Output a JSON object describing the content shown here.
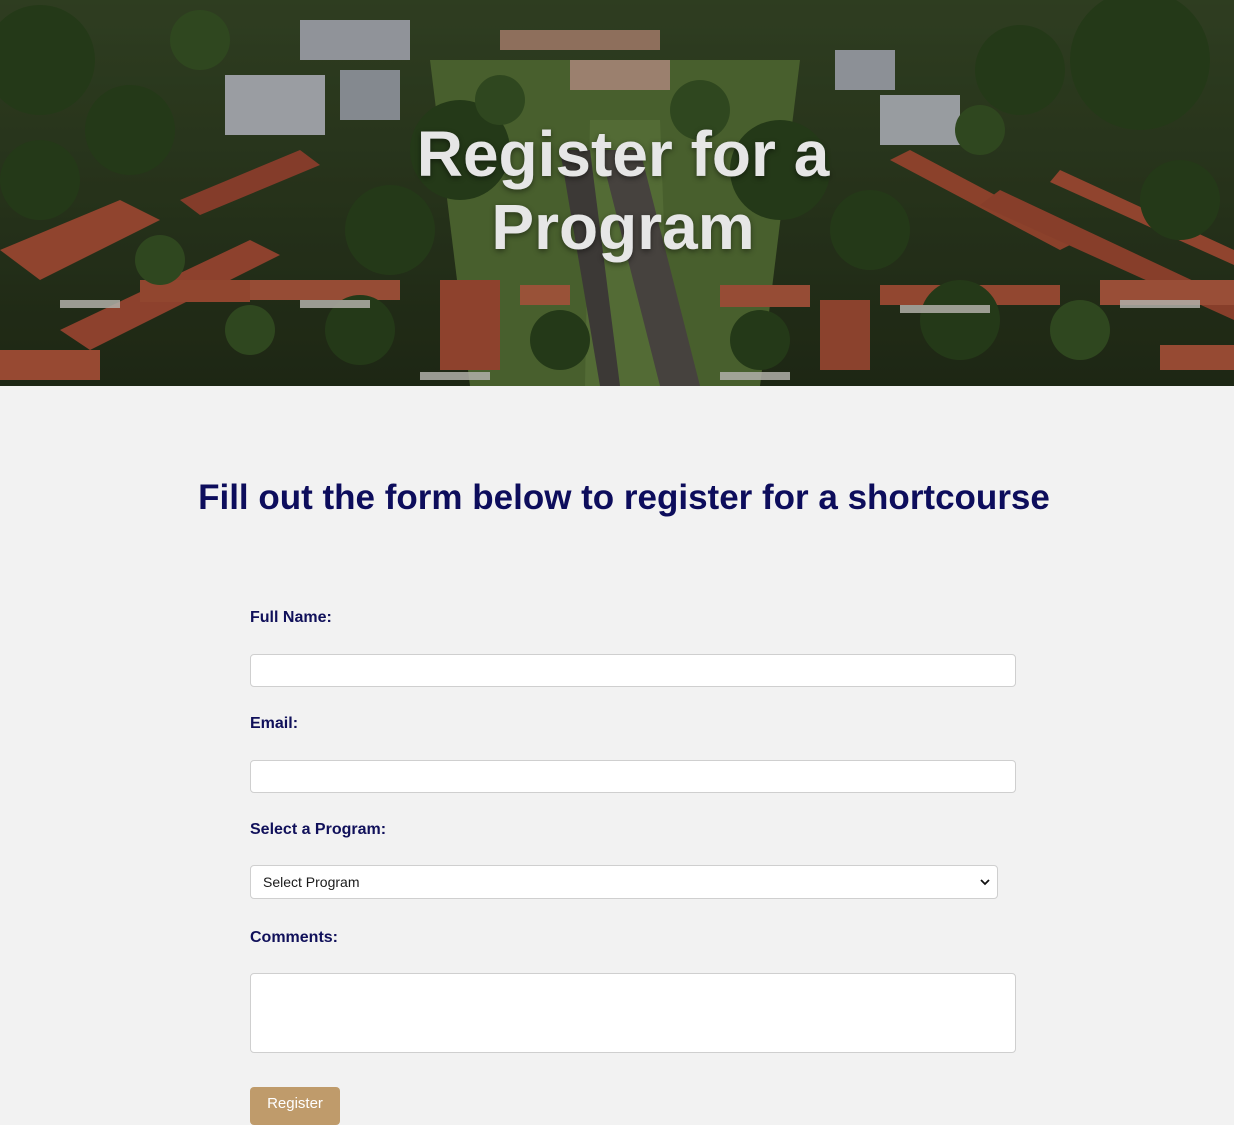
{
  "hero": {
    "title_line1": "Register for a",
    "title_line2": "Program"
  },
  "intro": {
    "heading": "Fill out the form below to register for a shortcourse"
  },
  "form": {
    "full_name_label": "Full Name:",
    "full_name_value": "",
    "email_label": "Email:",
    "email_value": "",
    "program_label": "Select a Program:",
    "program_selected": "Select Program",
    "comments_label": "Comments:",
    "comments_value": "",
    "submit_label": "Register"
  },
  "colors": {
    "heading": "#0d0d5c",
    "label": "#10105a",
    "button": "#bf9b6b",
    "background": "#f2f2f2"
  }
}
